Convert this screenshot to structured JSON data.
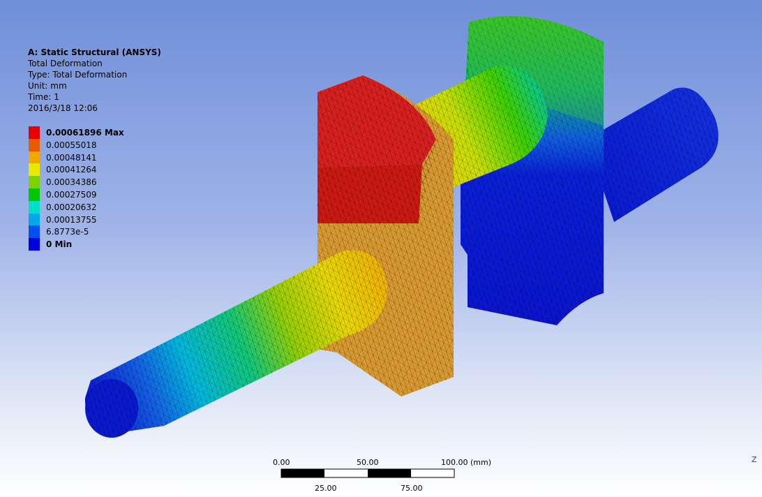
{
  "info": {
    "title": "A: Static Structural (ANSYS)",
    "result": "Total Deformation",
    "type": "Type: Total Deformation",
    "unit": "Unit: mm",
    "time": "Time: 1",
    "date": "2016/3/18 12:06"
  },
  "legend": [
    {
      "label": "0.00061896 Max",
      "color": "#e60000",
      "bold": true
    },
    {
      "label": "0.00055018",
      "color": "#e65c00",
      "bold": false
    },
    {
      "label": "0.00048141",
      "color": "#f0a800",
      "bold": false
    },
    {
      "label": "0.00041264",
      "color": "#e8e800",
      "bold": false
    },
    {
      "label": "0.00034386",
      "color": "#7fd000",
      "bold": false
    },
    {
      "label": "0.00027509",
      "color": "#00c800",
      "bold": false
    },
    {
      "label": "0.00020632",
      "color": "#00e0c8",
      "bold": false
    },
    {
      "label": "0.00013755",
      "color": "#00a8e8",
      "bold": false
    },
    {
      "label": "6.8773e-5",
      "color": "#0050f0",
      "bold": false
    },
    {
      "label": "0 Min",
      "color": "#0000d8",
      "bold": true
    }
  ],
  "scale": {
    "top_labels": [
      "0.00",
      "50.00",
      "100.00 (mm)"
    ],
    "bottom_labels": [
      "25.00",
      "75.00"
    ]
  },
  "axis": {
    "label": "Z"
  }
}
